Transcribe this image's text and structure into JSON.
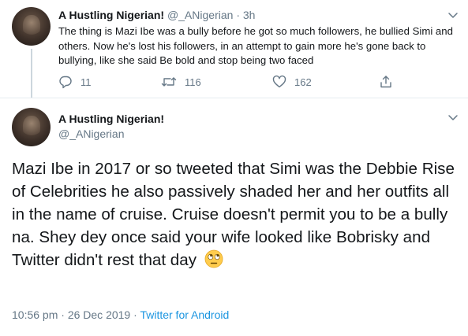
{
  "reply_tweet": {
    "display_name": "A Hustling Nigerian!",
    "handle": "@_ANigerian",
    "separator": "·",
    "time": "3h",
    "text": "The thing is Mazi Ibe was a bully before he got so much followers, he bullied Simi and others. Now he's lost his followers, in an attempt to gain more he's gone back to bullying, like she said Be bold and stop being two faced",
    "replies": "11",
    "retweets": "116",
    "likes": "162"
  },
  "main_tweet": {
    "display_name": "A Hustling Nigerian!",
    "handle": "@_ANigerian",
    "text": "Mazi Ibe in 2017 or so tweeted that Simi was the Debbie Rise of Celebrities he also passively shaded her and her outfits all in the name of cruise. Cruise doesn't permit you to be a bully na. Shey dey once said your wife looked like Bobrisky and Twitter didn't rest that day",
    "emoji": "face-with-rolling-eyes-icon",
    "time": "10:56 pm",
    "separator": "·",
    "date": "26 Dec 2019",
    "source": "Twitter for Android"
  },
  "colors": {
    "text": "#14171a",
    "muted": "#657786",
    "link": "#1b95e0",
    "divider": "#e6ecf0",
    "thread_line": "#ccd6dd"
  }
}
